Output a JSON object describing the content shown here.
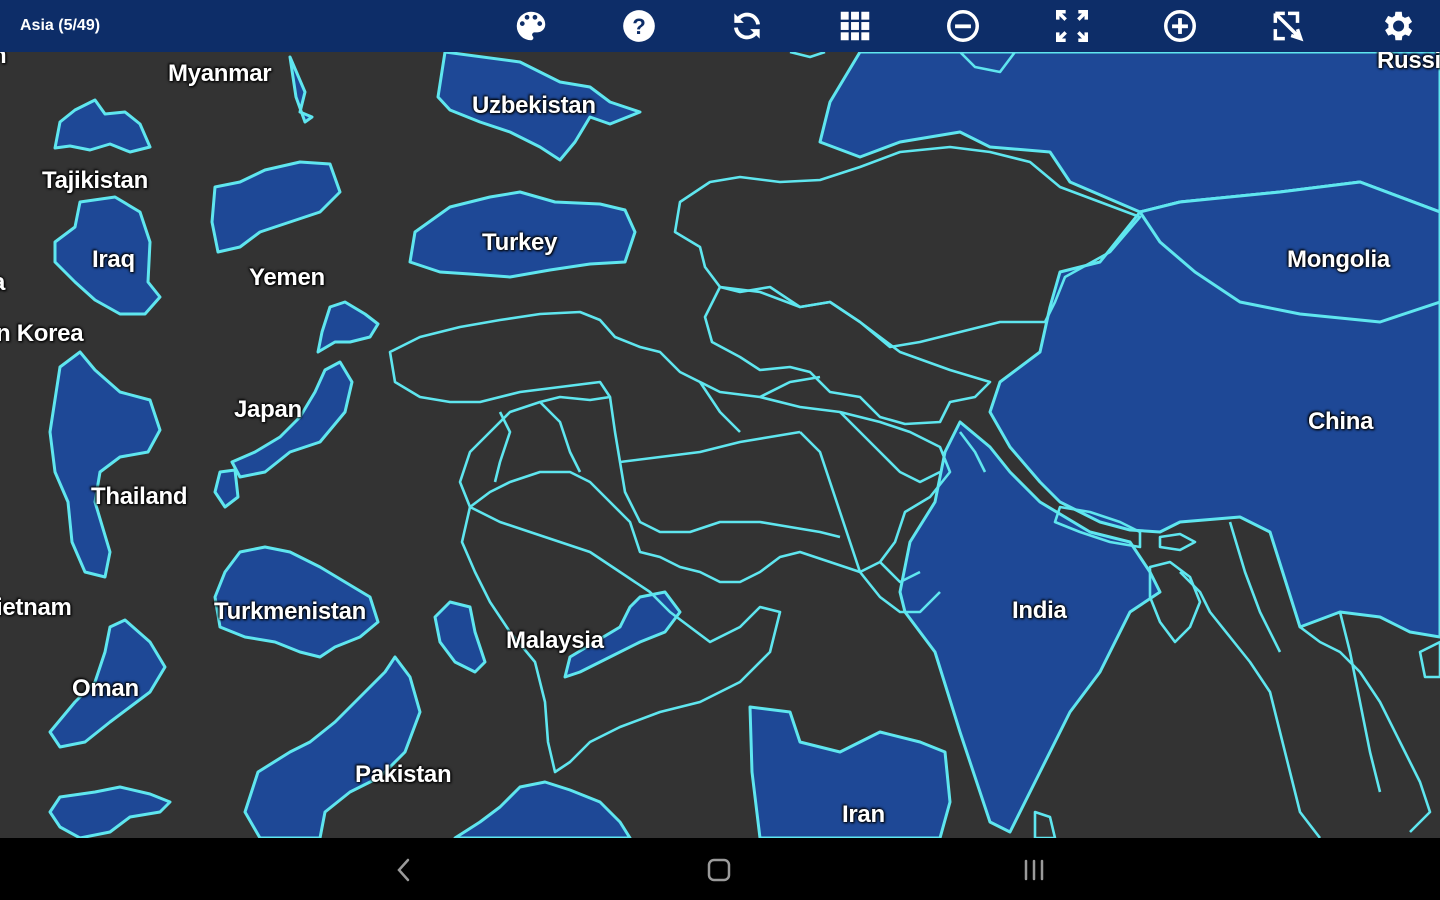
{
  "app": {
    "title": "Asia (5/49)"
  },
  "toolbar": {
    "icons": [
      "palette-icon",
      "help-icon",
      "refresh-icon",
      "grid-icon",
      "zoom-out-icon",
      "fullscreen-icon",
      "zoom-in-icon",
      "move-icon",
      "settings-icon"
    ]
  },
  "colors": {
    "toolbar_bg": "#0d2d68",
    "map_bg": "#333333",
    "country_fill": "#1e4896",
    "border": "#5fe6ef"
  },
  "pieces": {
    "myanmar": "Myanmar",
    "uzbekistan": "Uzbekistan",
    "tajikistan": "Tajikistan",
    "turkey": "Turkey",
    "iraq": "Iraq",
    "yemen": "Yemen",
    "north_korea": "n Korea",
    "japan": "Japan",
    "thailand": "Thailand",
    "vietnam": "ietnam",
    "turkmenistan": "Turkmenistan",
    "malaysia": "Malaysia",
    "oman": "Oman",
    "pakistan": "Pakistan",
    "cut_left_1": "n",
    "cut_left_2": "a"
  },
  "placed": {
    "russia": "Russi",
    "mongolia": "Mongolia",
    "china": "China",
    "india": "India",
    "iran": "Iran"
  },
  "navbar": {
    "icons": [
      "back-icon",
      "home-icon",
      "recents-icon"
    ]
  }
}
